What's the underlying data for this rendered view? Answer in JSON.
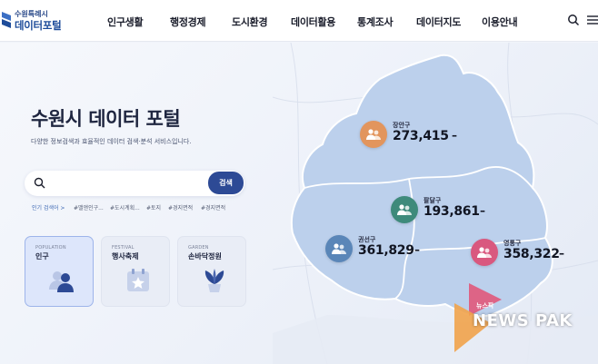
{
  "header": {
    "logo_sub": "수원특례시",
    "logo_main": "데이터포털",
    "nav": [
      "인구생활",
      "행정경제",
      "도시환경",
      "데이터활용",
      "통계조사",
      "데이터지도",
      "이용안내"
    ],
    "search_icon": "search-icon",
    "menu_icon": "hamburger-menu-icon"
  },
  "hero": {
    "title": "수원시 데이터 포털",
    "description": "다양한 정보검색과 효율적인 데이터 검색·분석 서비스입니다.",
    "search": {
      "value": "",
      "placeholder": "",
      "button_label": "검색"
    },
    "popular": {
      "label": "인기 검색어 >",
      "tags": [
        "#밸앤인구...",
        "#도시계획...",
        "#토지",
        "#경지면적",
        "#경지면적"
      ]
    }
  },
  "cards": [
    {
      "en": "POPULATION",
      "ko": "인구",
      "icon": "people-icon"
    },
    {
      "en": "FESTIVAL",
      "ko": "행사축제",
      "icon": "calendar-star-icon"
    },
    {
      "en": "GARDEN",
      "ko": "손바닥정원",
      "icon": "plant-icon"
    }
  ],
  "districts": [
    {
      "name": "장안구",
      "population": "273,415",
      "color": "#e2955d"
    },
    {
      "name": "팔달구",
      "population": "193,861",
      "color": "#3e8a7b"
    },
    {
      "name": "권선구",
      "population": "361,829",
      "color": "#5a86b8"
    },
    {
      "name": "영통구",
      "population": "358,322",
      "color": "#d9587f"
    }
  ],
  "watermark": {
    "small": "뉴스팍",
    "big": "NEWS PAK"
  },
  "colors": {
    "accent": "#2d4a95",
    "map_fill": "#b9cdea",
    "map_stroke": "#ffffff"
  }
}
